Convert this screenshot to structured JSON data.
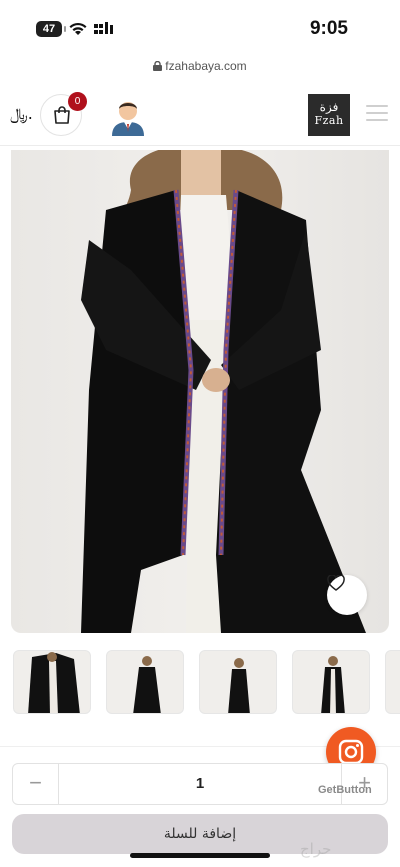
{
  "status_bar": {
    "battery": "47",
    "time": "9:05"
  },
  "browser": {
    "url": "fzahabaya.com"
  },
  "header": {
    "currency_symbol": "﷼.",
    "cart_count": "0",
    "logo_ar": "فزة",
    "logo_en": "Fzah"
  },
  "product": {
    "quantity": "1",
    "minus_label": "−",
    "plus_label": "+",
    "add_to_cart_label": "إضافة للسلة"
  },
  "widget": {
    "getbutton_label": "GetButton"
  },
  "watermark": "حراج",
  "colors": {
    "accent": "#f05a22",
    "badge": "#b0101c",
    "button_bg": "#d8d4d8"
  }
}
